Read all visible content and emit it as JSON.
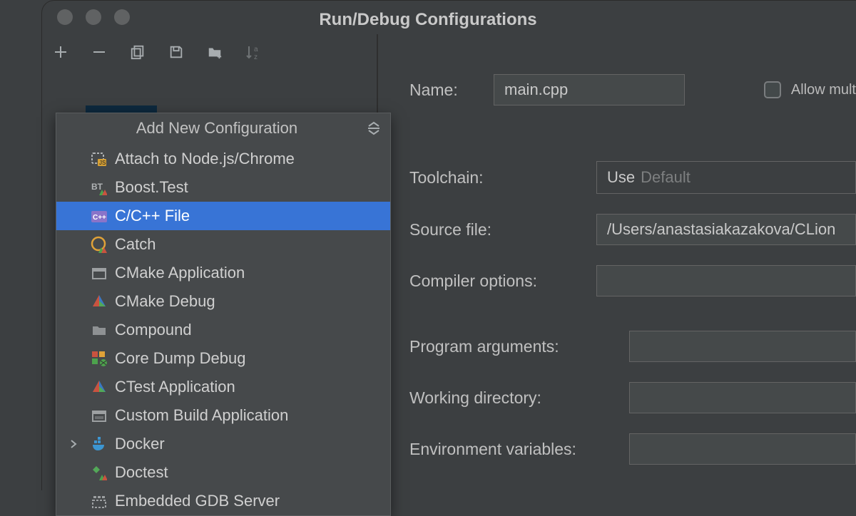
{
  "window": {
    "title": "Run/Debug Configurations"
  },
  "popup": {
    "title": "Add New Configuration",
    "items": [
      {
        "label": "Attach to Node.js/Chrome",
        "icon": "nodejs",
        "has_children": false
      },
      {
        "label": "Boost.Test",
        "icon": "boosttest",
        "has_children": false
      },
      {
        "label": "C/C++ File",
        "icon": "cpp",
        "has_children": false,
        "selected": true
      },
      {
        "label": "Catch",
        "icon": "catch",
        "has_children": false
      },
      {
        "label": "CMake Application",
        "icon": "cmakeapp",
        "has_children": false
      },
      {
        "label": "CMake Debug",
        "icon": "cmakedbg",
        "has_children": false
      },
      {
        "label": "Compound",
        "icon": "compound",
        "has_children": false
      },
      {
        "label": "Core Dump Debug",
        "icon": "coredump",
        "has_children": false
      },
      {
        "label": "CTest Application",
        "icon": "ctest",
        "has_children": false
      },
      {
        "label": "Custom Build Application",
        "icon": "custombld",
        "has_children": false
      },
      {
        "label": "Docker",
        "icon": "docker",
        "has_children": true
      },
      {
        "label": "Doctest",
        "icon": "doctest",
        "has_children": false
      },
      {
        "label": "Embedded GDB Server",
        "icon": "gdb",
        "has_children": false
      }
    ]
  },
  "form": {
    "name_label": "Name:",
    "name_value": "main.cpp",
    "allow_multiple_label": "Allow mult",
    "toolchain_label": "Toolchain:",
    "toolchain_prefix": "Use",
    "toolchain_value": "Default",
    "source_file_label": "Source file:",
    "source_file_value": "/Users/anastasiakazakova/CLion",
    "compiler_options_label": "Compiler options:",
    "compiler_options_value": "",
    "program_arguments_label": "Program arguments:",
    "program_arguments_value": "",
    "working_directory_label": "Working directory:",
    "working_directory_value": "",
    "environment_variables_label": "Environment variables:",
    "environment_variables_value": ""
  }
}
